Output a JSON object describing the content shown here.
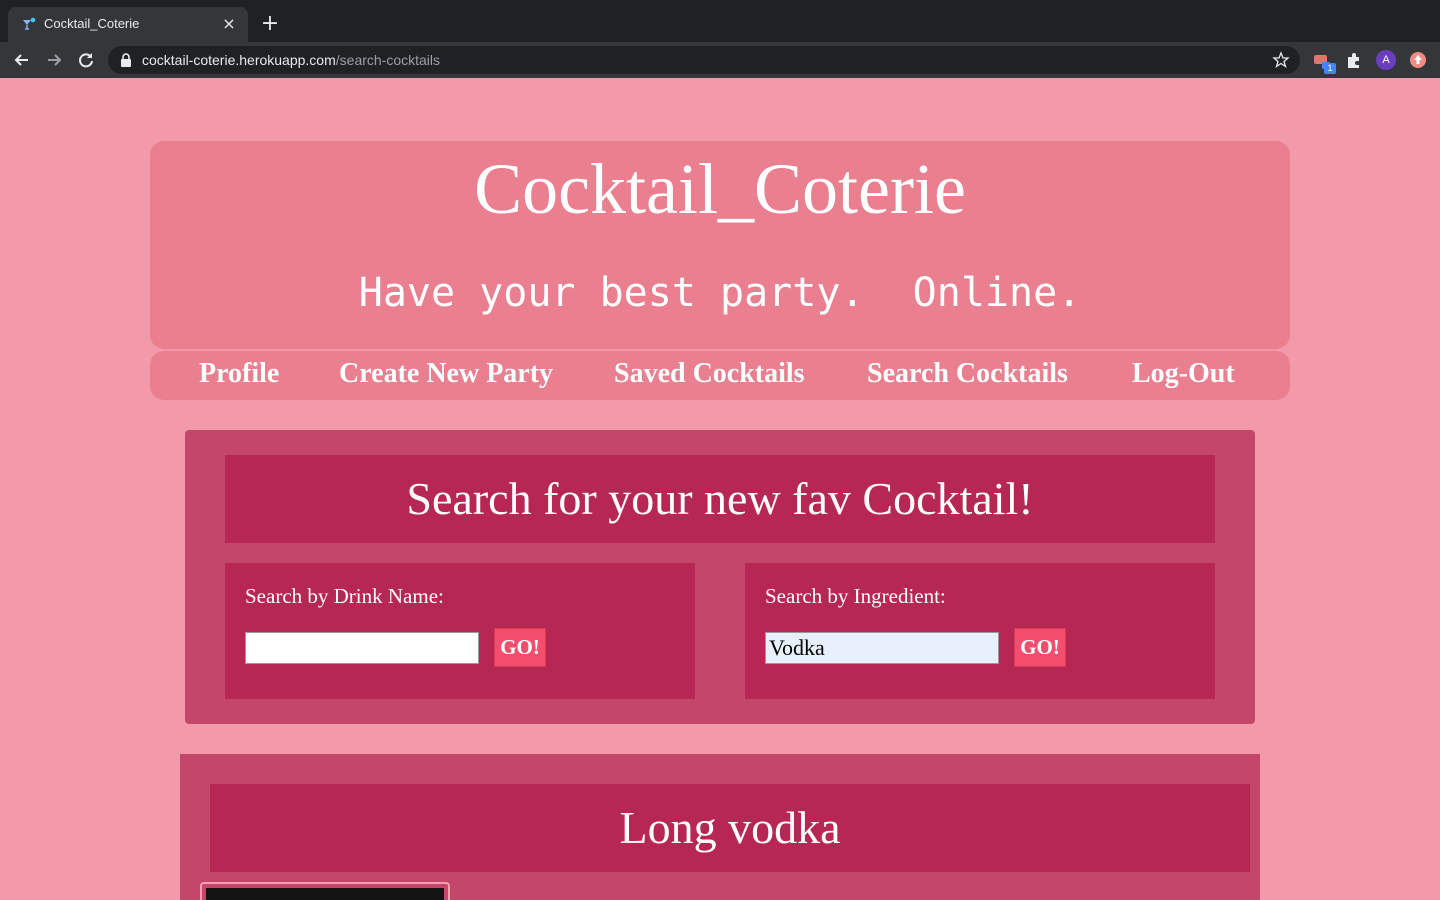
{
  "browser": {
    "tab_title": "Cocktail_Coterie",
    "tab_close": "×",
    "new_tab": "+",
    "url_host": "cocktail-coterie.herokuapp.com",
    "url_path": "/search-cocktails",
    "profile_initial": "A",
    "extension_badge": "1"
  },
  "header": {
    "title": "Cocktail_Coterie",
    "tagline": "Have your best party.  Online."
  },
  "nav": {
    "items": [
      {
        "label": "Profile"
      },
      {
        "label": "Create New Party"
      },
      {
        "label": "Saved Cocktails"
      },
      {
        "label": "Search Cocktails"
      },
      {
        "label": "Log-Out"
      }
    ]
  },
  "search": {
    "heading": "Search for your new fav Cocktail!",
    "by_name": {
      "label": "Search by Drink Name:",
      "value": "",
      "button": "GO!"
    },
    "by_ingredient": {
      "label": "Search by Ingredient:",
      "value": "Vodka",
      "button": "GO!"
    }
  },
  "results": [
    {
      "title": "Long vodka"
    }
  ],
  "colors": {
    "page_bg": "#f29aa9",
    "header_bg": "#ea7f90",
    "panel_bg": "#c4466b",
    "card_bg": "#b72754",
    "button_bg": "#f54d6e",
    "autofill_bg": "#e8f0fe"
  }
}
